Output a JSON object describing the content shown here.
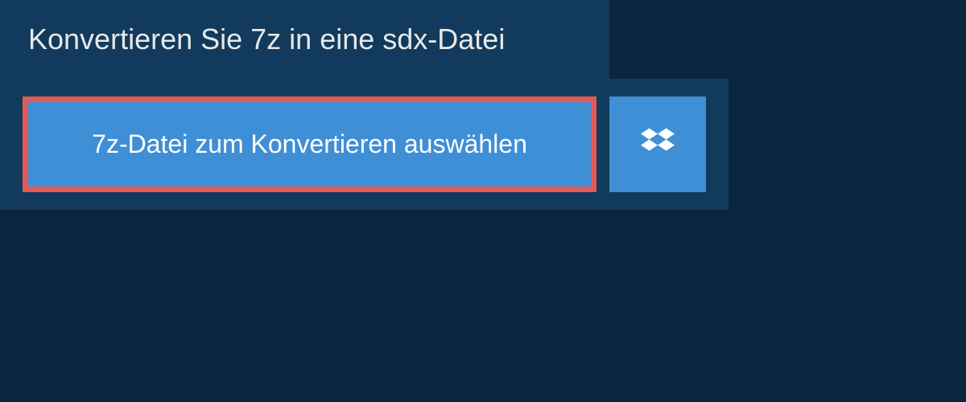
{
  "header": {
    "title": "Konvertieren Sie 7z in eine sdx-Datei"
  },
  "actions": {
    "select_file_label": "7z-Datei zum Konvertieren auswählen"
  },
  "colors": {
    "background": "#0a2540",
    "panel": "#123a5c",
    "button": "#3f8fd6",
    "highlight_border": "#e15a54"
  }
}
